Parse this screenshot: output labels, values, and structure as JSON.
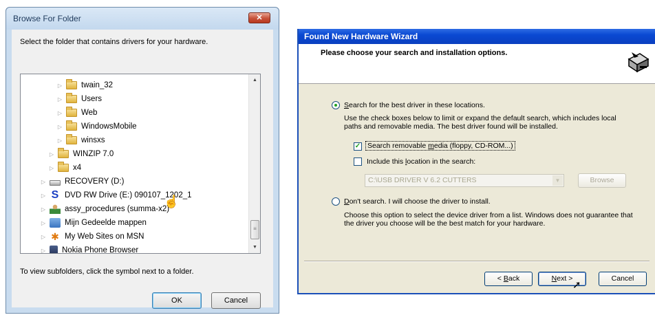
{
  "browse_dialog": {
    "title": "Browse For Folder",
    "close_glyph": "✕",
    "description": "Select the folder that contains drivers for your hardware.",
    "tree_items": [
      {
        "label": "twain_32",
        "icon": "folder-icon"
      },
      {
        "label": "Users",
        "icon": "folder-icon"
      },
      {
        "label": "Web",
        "icon": "folder-icon"
      },
      {
        "label": "WindowsMobile",
        "icon": "folder-icon"
      },
      {
        "label": "winsxs",
        "icon": "folder-icon"
      },
      {
        "label": "WINZIP 7.0",
        "icon": "folder-icon"
      },
      {
        "label": "x4",
        "icon": "folder-icon"
      },
      {
        "label": "RECOVERY (D:)",
        "icon": "drive-icon"
      },
      {
        "label": "DVD RW Drive (E:) 090107_1202_1",
        "icon": "dvd-drive-icon"
      },
      {
        "label": "assy_procedures (summa-x2)",
        "icon": "user-folder-icon"
      },
      {
        "label": "Mijn Gedeelde mappen",
        "icon": "shared-folder-icon"
      },
      {
        "label": "My Web Sites on MSN",
        "icon": "msn-icon"
      },
      {
        "label": "Nokia Phone Browser",
        "icon": "phone-icon"
      }
    ],
    "hint": "To view subfolders, click the symbol next to a folder.",
    "ok_label": "OK",
    "cancel_label": "Cancel"
  },
  "wizard": {
    "title": "Found New Hardware Wizard",
    "heading": "Please choose your search and installation options.",
    "option_search": {
      "label_first": "S",
      "label_rest": "earch for the best driver in these locations.",
      "selected": true
    },
    "search_description_1": "Use the check boxes below to limit or expand the default search, which includes local",
    "search_description_2": "paths and removable media. The best driver found will be installed.",
    "check_removable": {
      "label_pre": "Search removable ",
      "label_key": "m",
      "label_post": "edia (floppy, CD-ROM...)",
      "checked": true
    },
    "check_location": {
      "label_pre": "Include this ",
      "label_key": "l",
      "label_post": "ocation in the search:",
      "checked": false
    },
    "location_value": "C:\\USB DRIVER V 6.2 CUTTERS",
    "browse_label": "Browse",
    "option_dont_search": {
      "label_first": "D",
      "label_rest": "on't search. I will choose the driver to install.",
      "selected": false
    },
    "dont_search_description_1": "Choose this option to select the device driver from a list.  Windows does not guarantee that",
    "dont_search_description_2": "the driver you choose will be the best match for your hardware.",
    "back_label_pre": "< ",
    "back_key": "B",
    "back_label_post": "ack",
    "next_key": "N",
    "next_label_post": "ext >",
    "cancel_label": "Cancel"
  }
}
